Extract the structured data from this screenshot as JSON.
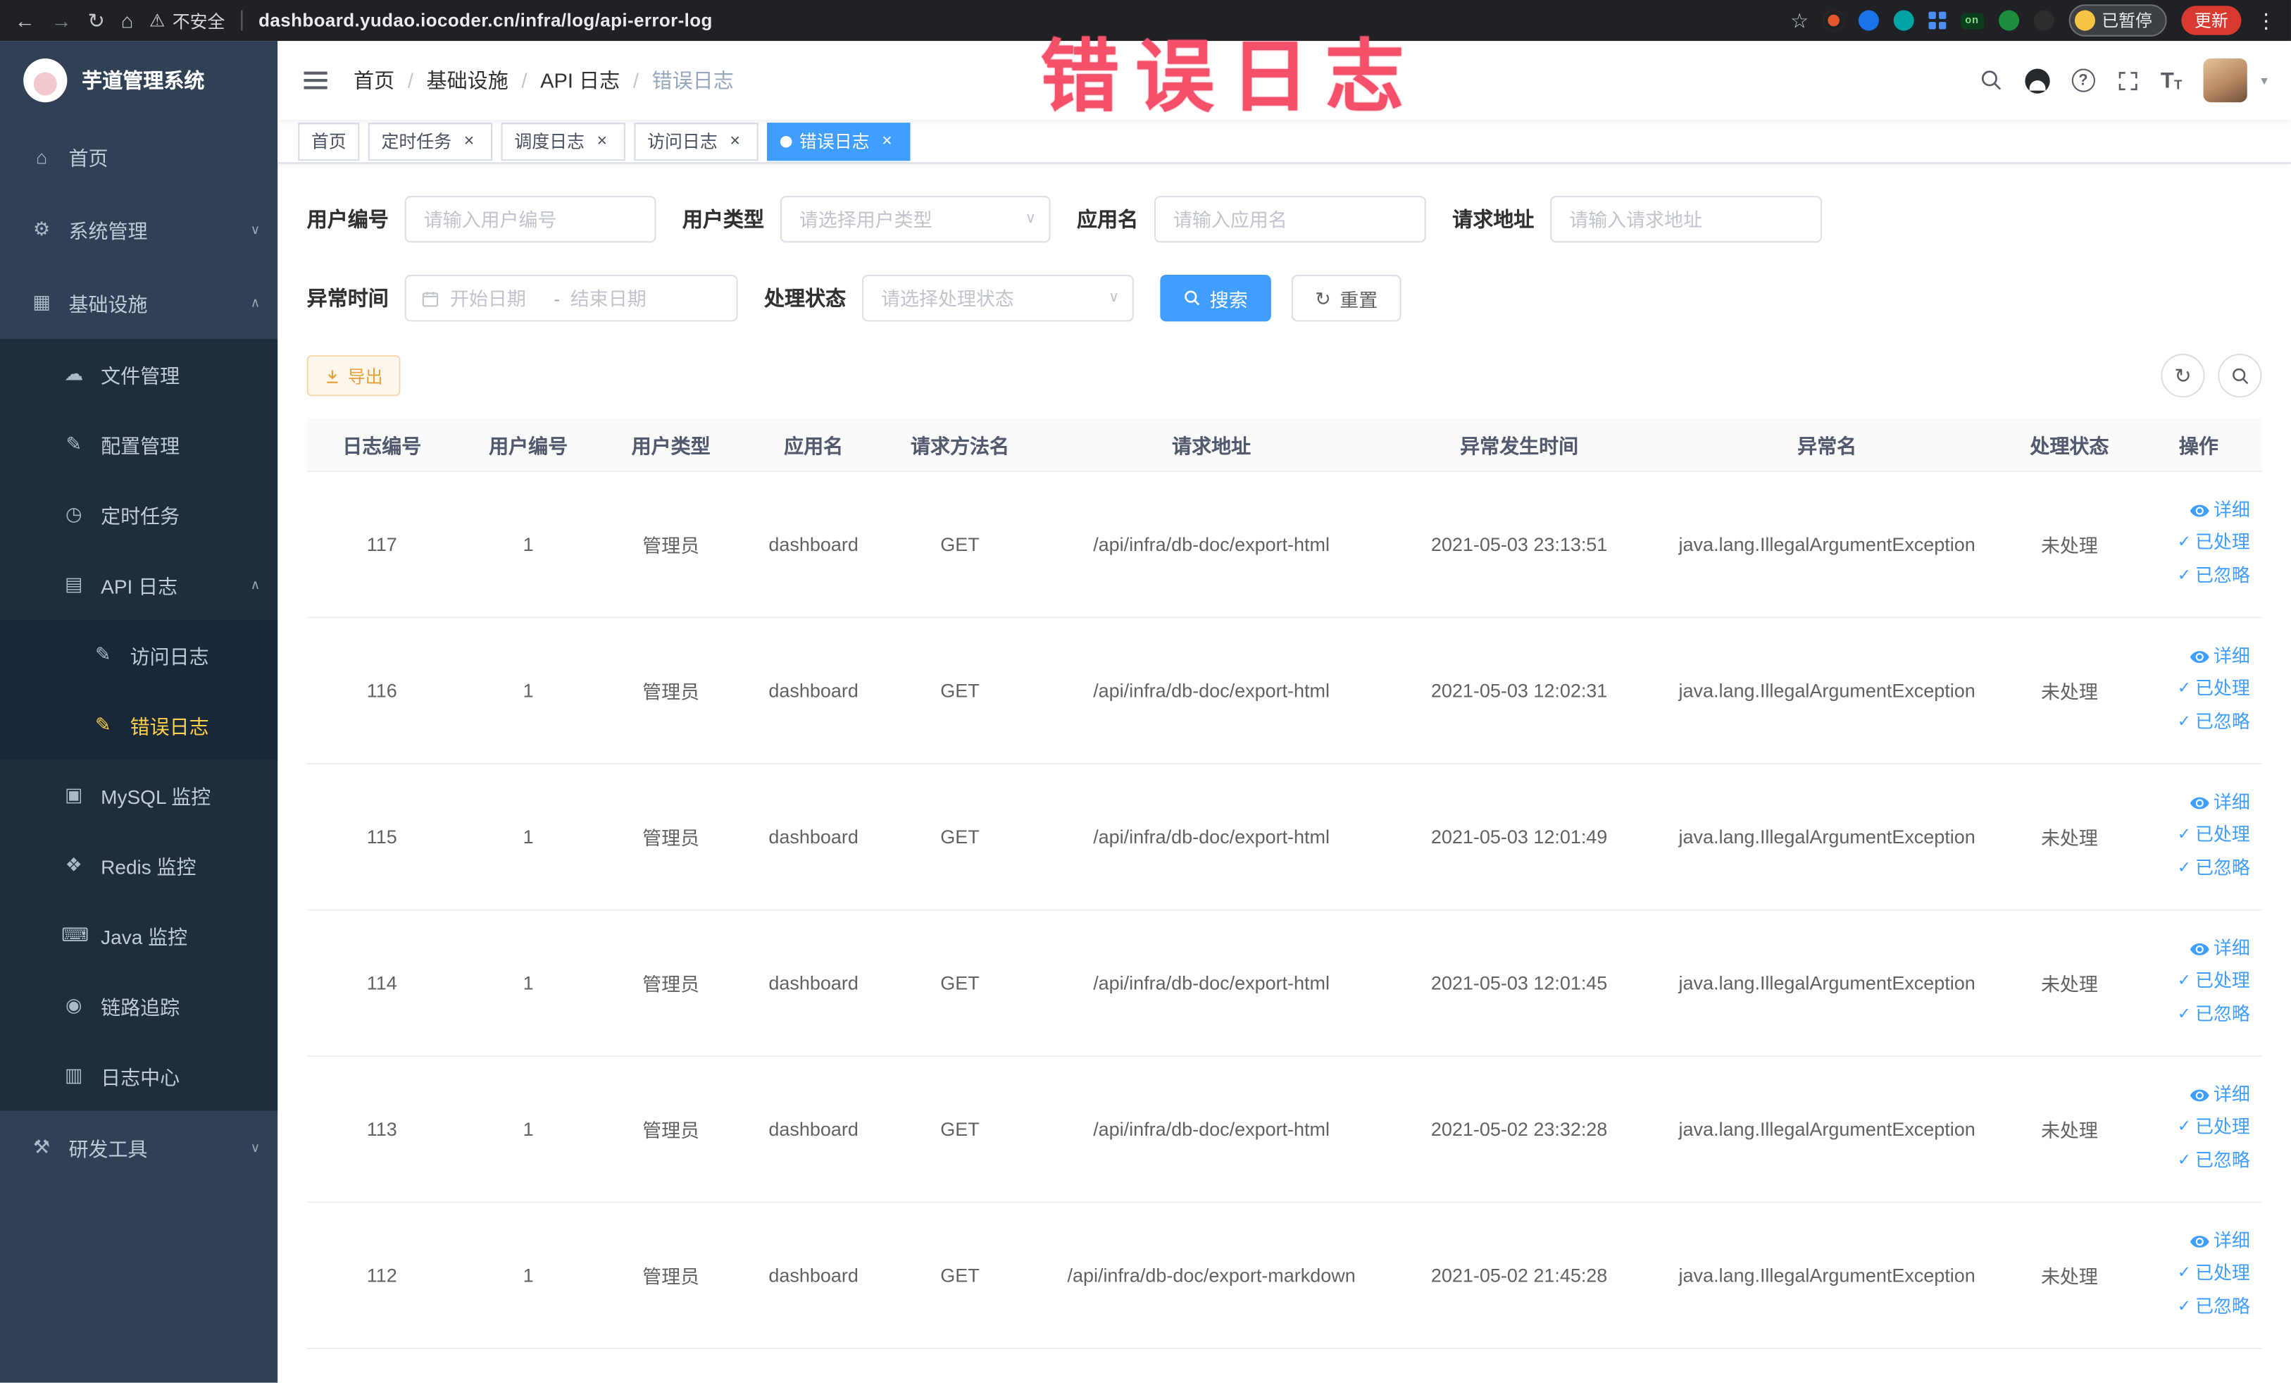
{
  "browser": {
    "security_label": "不安全",
    "url": "dashboard.yudao.iocoder.cn/infra/log/api-error-log",
    "extension_on_badge": "on",
    "paused_badge": "已暂停",
    "update_button": "更新"
  },
  "annotation": {
    "text": "错误日志"
  },
  "sidebar": {
    "logo_title": "芋道管理系统",
    "items": [
      {
        "name": "home",
        "label": "首页",
        "icon": "home-icon",
        "level": 0
      },
      {
        "name": "system-management",
        "label": "系统管理",
        "icon": "gear-icon",
        "level": 0,
        "arrow": "down"
      },
      {
        "name": "infrastructure",
        "label": "基础设施",
        "icon": "infra-icon",
        "level": 0,
        "arrow": "up",
        "expanded": true
      },
      {
        "name": "file-management",
        "label": "文件管理",
        "icon": "cloud-icon",
        "level": 1
      },
      {
        "name": "config-management",
        "label": "配置管理",
        "icon": "edit-icon",
        "level": 1
      },
      {
        "name": "scheduled-tasks",
        "label": "定时任务",
        "icon": "timer-icon",
        "level": 1
      },
      {
        "name": "api-logs",
        "label": "API 日志",
        "icon": "api-log-icon",
        "level": 1,
        "arrow": "up"
      },
      {
        "name": "access-logs",
        "label": "访问日志",
        "icon": "doc-edit-icon",
        "level": 2
      },
      {
        "name": "error-logs",
        "label": "错误日志",
        "icon": "doc-edit-icon",
        "level": 2,
        "active": true
      },
      {
        "name": "mysql-monitor",
        "label": "MySQL 监控",
        "icon": "database-icon",
        "level": 1
      },
      {
        "name": "redis-monitor",
        "label": "Redis 监控",
        "icon": "redis-icon",
        "level": 1
      },
      {
        "name": "java-monitor",
        "label": "Java 监控",
        "icon": "java-icon",
        "level": 1
      },
      {
        "name": "trace",
        "label": "链路追踪",
        "icon": "trace-icon",
        "level": 1
      },
      {
        "name": "log-center",
        "label": "日志中心",
        "icon": "log-center-icon",
        "level": 1
      },
      {
        "name": "dev-tools",
        "label": "研发工具",
        "icon": "tools-icon",
        "level": 0,
        "arrow": "down"
      }
    ]
  },
  "breadcrumb": {
    "items": [
      "首页",
      "基础设施",
      "API 日志",
      "错误日志"
    ]
  },
  "tabs": [
    {
      "name": "home",
      "label": "首页",
      "closable": false,
      "active": false
    },
    {
      "name": "scheduled-tasks",
      "label": "定时任务",
      "closable": true,
      "active": false
    },
    {
      "name": "schedule-logs",
      "label": "调度日志",
      "closable": true,
      "active": false
    },
    {
      "name": "access-logs",
      "label": "访问日志",
      "closable": true,
      "active": false
    },
    {
      "name": "error-logs",
      "label": "错误日志",
      "closable": true,
      "active": true
    }
  ],
  "filters": {
    "user_id": {
      "label": "用户编号",
      "placeholder": "请输入用户编号"
    },
    "user_type": {
      "label": "用户类型",
      "placeholder": "请选择用户类型"
    },
    "app_name": {
      "label": "应用名",
      "placeholder": "请输入应用名"
    },
    "request_url": {
      "label": "请求地址",
      "placeholder": "请输入请求地址"
    },
    "exception_time": {
      "label": "异常时间",
      "start_placeholder": "开始日期",
      "separator": "-",
      "end_placeholder": "结束日期"
    },
    "process_status": {
      "label": "处理状态",
      "placeholder": "请选择处理状态"
    },
    "search_button": "搜索",
    "reset_button": "重置"
  },
  "toolbar": {
    "export_button": "导出"
  },
  "table": {
    "columns": [
      "日志编号",
      "用户编号",
      "用户类型",
      "应用名",
      "请求方法名",
      "请求地址",
      "异常发生时间",
      "异常名",
      "处理状态",
      "操作"
    ],
    "actions": [
      "详细",
      "已处理",
      "已忽略"
    ],
    "rows": [
      {
        "id": "117",
        "user_id": "1",
        "user_type": "管理员",
        "app": "dashboard",
        "method": "GET",
        "url": "/api/infra/db-doc/export-html",
        "time": "2021-05-03 23:13:51",
        "exception": "java.lang.IllegalArgumentException",
        "status": "未处理"
      },
      {
        "id": "116",
        "user_id": "1",
        "user_type": "管理员",
        "app": "dashboard",
        "method": "GET",
        "url": "/api/infra/db-doc/export-html",
        "time": "2021-05-03 12:02:31",
        "exception": "java.lang.IllegalArgumentException",
        "status": "未处理"
      },
      {
        "id": "115",
        "user_id": "1",
        "user_type": "管理员",
        "app": "dashboard",
        "method": "GET",
        "url": "/api/infra/db-doc/export-html",
        "time": "2021-05-03 12:01:49",
        "exception": "java.lang.IllegalArgumentException",
        "status": "未处理"
      },
      {
        "id": "114",
        "user_id": "1",
        "user_type": "管理员",
        "app": "dashboard",
        "method": "GET",
        "url": "/api/infra/db-doc/export-html",
        "time": "2021-05-03 12:01:45",
        "exception": "java.lang.IllegalArgumentException",
        "status": "未处理"
      },
      {
        "id": "113",
        "user_id": "1",
        "user_type": "管理员",
        "app": "dashboard",
        "method": "GET",
        "url": "/api/infra/db-doc/export-html",
        "time": "2021-05-02 23:32:28",
        "exception": "java.lang.IllegalArgumentException",
        "status": "未处理"
      },
      {
        "id": "112",
        "user_id": "1",
        "user_type": "管理员",
        "app": "dashboard",
        "method": "GET",
        "url": "/api/infra/db-doc/export-markdown",
        "time": "2021-05-02 21:45:28",
        "exception": "java.lang.IllegalArgumentException",
        "status": "未处理"
      }
    ]
  }
}
